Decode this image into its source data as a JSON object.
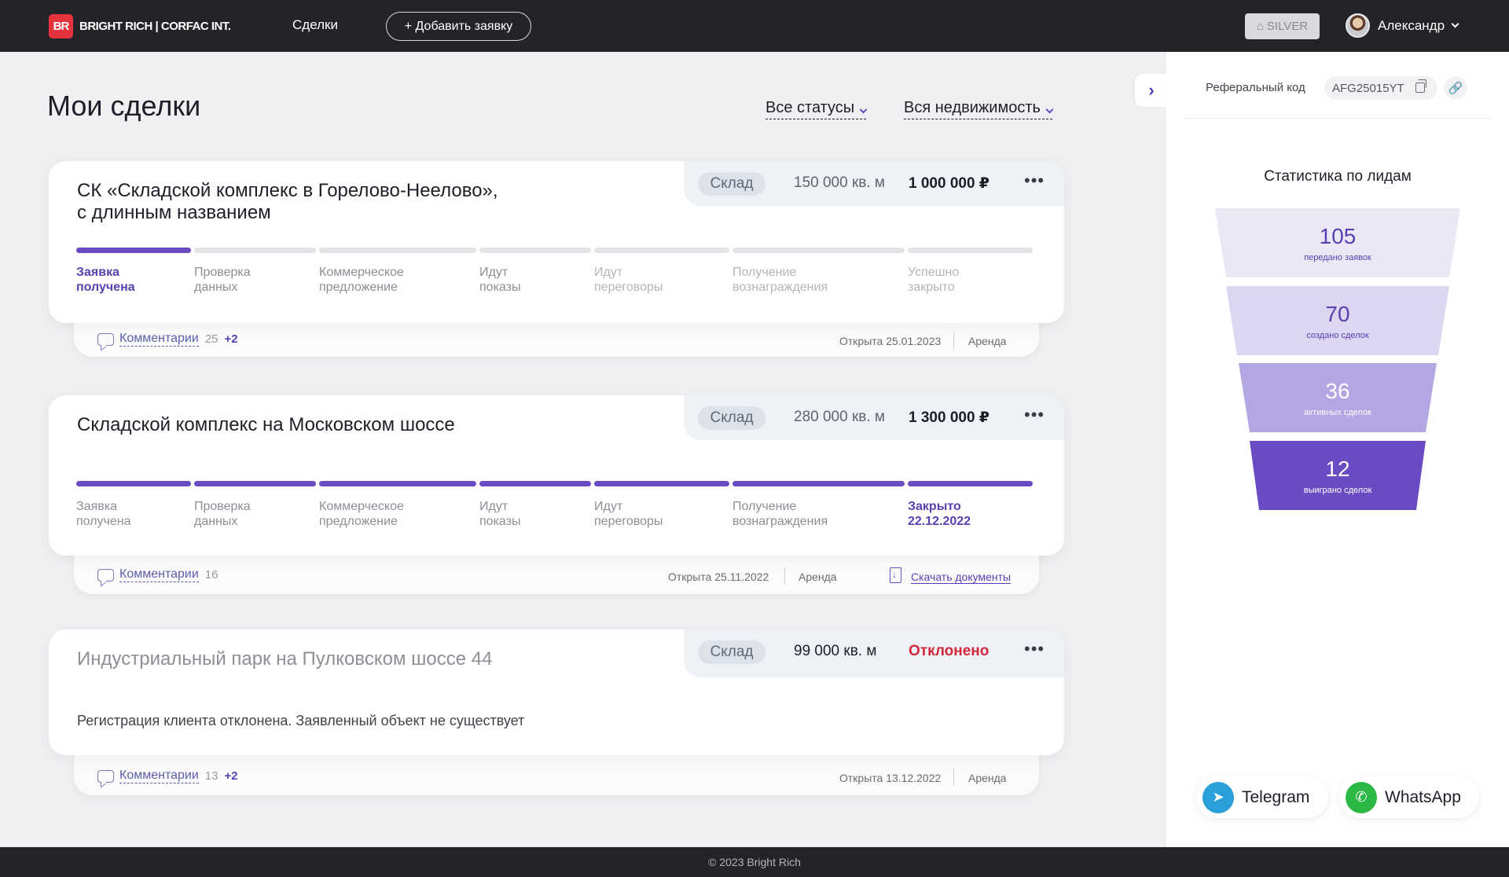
{
  "header": {
    "logo_mark": "BR",
    "logo_text": "BRIGHT RICH | CORFAC INT.",
    "nav_deals": "Сделки",
    "add_button": "+ Добавить заявку",
    "badge": "SILVER",
    "user_name": "Александр"
  },
  "main": {
    "title": "Мои сделки",
    "filters": {
      "status": "Все статусы",
      "property": "Вся недвижимость"
    }
  },
  "deals": [
    {
      "title_line1": "СК «Складской комплекс в Горелово-Неелово»,",
      "title_line2": "с длинным названием",
      "type": "Склад",
      "area": "150 000 кв. м",
      "price": "1 000 000 ₽",
      "stages": [
        {
          "l1": "Заявка",
          "l2": "получена"
        },
        {
          "l1": "Проверка",
          "l2": "данных"
        },
        {
          "l1": "Коммерческое",
          "l2": "предложение"
        },
        {
          "l1": "Идут",
          "l2": "показы"
        },
        {
          "l1": "Идут",
          "l2": "переговоры"
        },
        {
          "l1": "Получение",
          "l2": "вознаграждения"
        },
        {
          "l1": "Успешно",
          "l2": "закрыто"
        }
      ],
      "progress_stage": 1,
      "comments_label": "Комментарии",
      "comments_count": "25",
      "comments_new": "+2",
      "opened": "Открыта 25.01.2023",
      "deal_type": "Аренда"
    },
    {
      "title_line1": "Складской комплекс на Московском шоссе",
      "type": "Склад",
      "area": "280 000 кв. м",
      "price": "1 300 000 ₽",
      "stages": [
        {
          "l1": "Заявка",
          "l2": "получена"
        },
        {
          "l1": "Проверка",
          "l2": "данных"
        },
        {
          "l1": "Коммерческое",
          "l2": "предложение"
        },
        {
          "l1": "Идут",
          "l2": "показы"
        },
        {
          "l1": "Идут",
          "l2": "переговоры"
        },
        {
          "l1": "Получение",
          "l2": "вознаграждения"
        },
        {
          "l1": "Закрыто",
          "l2": "22.12.2022"
        }
      ],
      "progress_stage": 7,
      "comments_label": "Комментарии",
      "comments_count": "16",
      "opened": "Открыта 25.11.2022",
      "deal_type": "Аренда",
      "download": "Скачать документы"
    },
    {
      "title_line1": "Индустриальный парк на Пулковском шоссе 44",
      "type": "Склад",
      "area": "99 000 кв. м",
      "status": "Отклонено",
      "note": "Регистрация клиента отклонена. Заявленный объект не существует",
      "comments_label": "Комментарии",
      "comments_count": "13",
      "comments_new": "+2",
      "opened": "Открыта 13.12.2022",
      "deal_type": "Аренда"
    }
  ],
  "sidebar": {
    "referral_label": "Реферальный код",
    "referral_code": "AFG25015YT",
    "stats_title": "Статистика по лидам",
    "funnel": [
      {
        "value": "105",
        "label": "передано заявок",
        "color": "#ebe8f6",
        "text_color": "#5a3fb0"
      },
      {
        "value": "70",
        "label": "создано сделок",
        "color": "#dcd6f1",
        "text_color": "#5a3fb0"
      },
      {
        "value": "36",
        "label": "активных сделок",
        "color": "#b4a6e3",
        "text_color": "#ffffff"
      },
      {
        "value": "12",
        "label": "выиграно сделок",
        "color": "#6a4bc4",
        "text_color": "#ffffff"
      }
    ],
    "telegram": "Telegram",
    "whatsapp": "WhatsApp"
  },
  "footer": {
    "copyright": "© 2023 Bright Rich"
  },
  "colors": {
    "accent": "#6a4bc4",
    "danger": "#d2283b",
    "brand_red": "#e5333d",
    "dark": "#242428"
  }
}
